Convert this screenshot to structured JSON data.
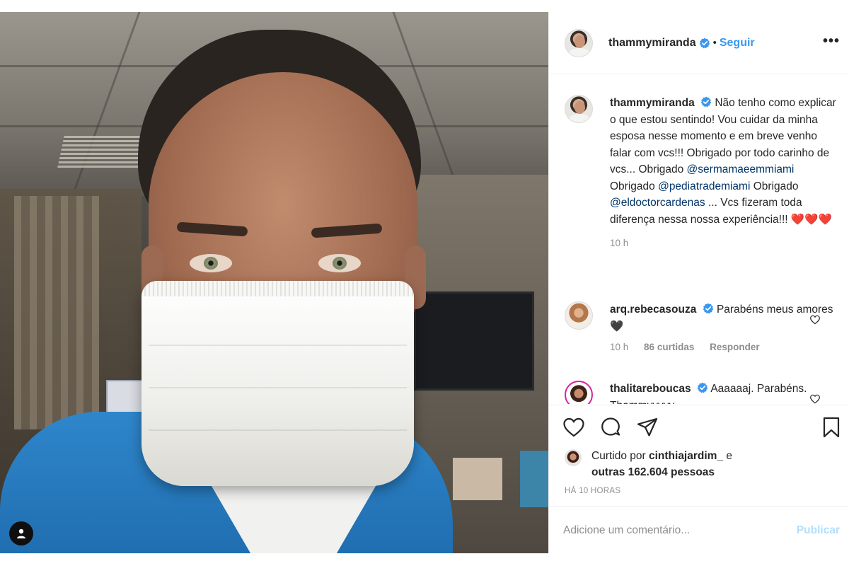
{
  "post": {
    "author": "thammymiranda",
    "follow_label": "Seguir",
    "separator": "•",
    "more_label": "•••"
  },
  "caption": {
    "username": "thammymiranda",
    "text_1": "Não tenho como explicar o que estou sentindo! Vou cuidar da minha esposa nesse momento e em breve venho falar com vcs!!! Obrigado por todo carinho de vcs... Obrigado ",
    "mention_1": "@sermamaeemmiami",
    "text_2": " Obrigado ",
    "mention_2": "@pediatrademiami",
    "text_3": " Obrigado ",
    "mention_3": "@eldoctorcardenas",
    "text_4": " ... Vcs fizeram toda diferença nessa nossa experiência!!! ",
    "hearts": "❤️❤️❤️",
    "time": "10 h"
  },
  "comments": [
    {
      "username": "arq.rebecasouza",
      "text": "Parabéns meus amores 🖤",
      "time": "10 h",
      "likes": "86 curtidas",
      "reply": "Responder"
    },
    {
      "username": "thalitareboucas",
      "text": "Aaaaaaj. Parabéns. Thammyyyyy"
    }
  ],
  "likes": {
    "prefix": "Curtido por ",
    "user": "cinthiajardim_",
    "middle": " e",
    "others": "outras 162.604 pessoas"
  },
  "timestamp": "HÁ 10 HORAS",
  "comment_input": {
    "placeholder": "Adicione um comentário...",
    "publish": "Publicar"
  },
  "colors": {
    "accent": "#3897f0",
    "mention": "#003569",
    "muted": "#8e8e8e",
    "publish_disabled": "#b2dffc"
  }
}
